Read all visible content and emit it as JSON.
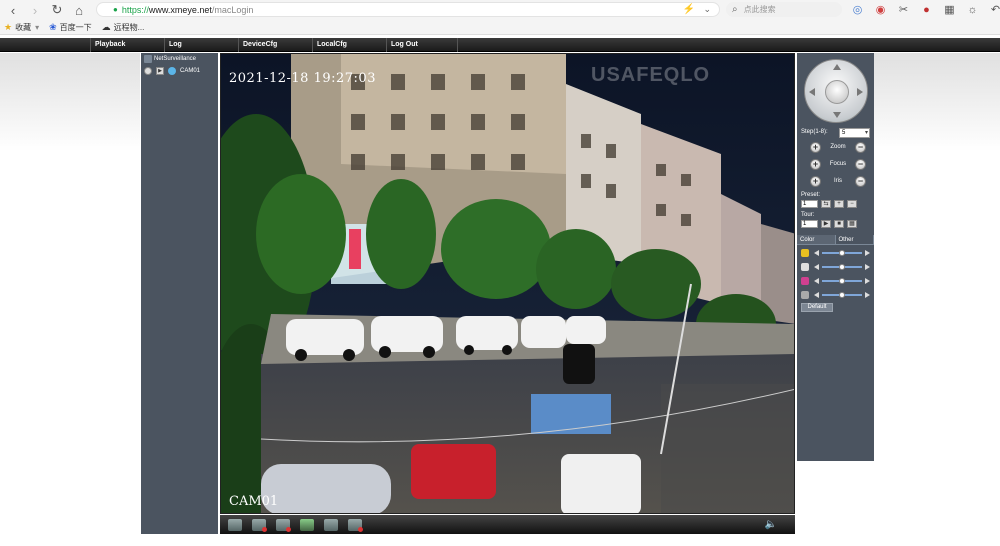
{
  "browser": {
    "url_https": "https://",
    "url_host": "www.xmeye.net",
    "url_path": "/macLogin",
    "search_placeholder": "点此搜索"
  },
  "bookmarks": [
    {
      "label": "收藏"
    },
    {
      "label": "百度一下"
    },
    {
      "label": "远程物..."
    }
  ],
  "menu": [
    {
      "label": "Playback"
    },
    {
      "label": "Log"
    },
    {
      "label": "DeviceCfg"
    },
    {
      "label": "LocalCfg"
    },
    {
      "label": "Log Out"
    }
  ],
  "tree": {
    "root_label": "NetSurveillance",
    "camera_label": "CAM01"
  },
  "video": {
    "osd_time": "2021-12-18  19:27:03",
    "osd_channel": "CAM01",
    "watermark": "USAFEQLO"
  },
  "ptz": {
    "step_label": "Step(1-8):",
    "step_value": "5",
    "zoom_label": "Zoom",
    "focus_label": "Focus",
    "iris_label": "Iris",
    "preset_label": "Preset:",
    "preset_value": "1",
    "tour_label": "Tour:",
    "tour_value": "1",
    "tab_color": "Color",
    "tab_other": "Other",
    "default_label": "Default"
  },
  "sliders": [
    {
      "name": "brightness",
      "level": 0.5,
      "color": "#e8c020"
    },
    {
      "name": "contrast",
      "level": 0.5,
      "color": "#dddddd"
    },
    {
      "name": "saturation",
      "level": 0.5,
      "color": "#d04090"
    },
    {
      "name": "hue",
      "level": 0.5,
      "color": "#aaaaaa"
    }
  ]
}
